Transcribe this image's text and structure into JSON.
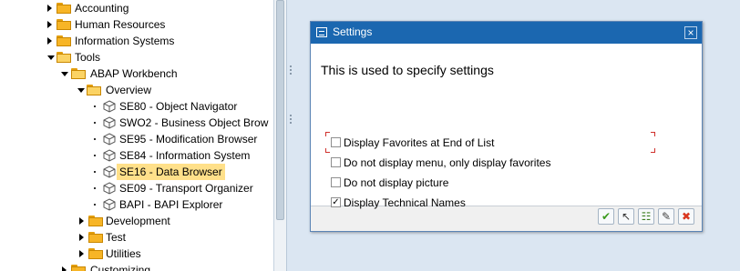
{
  "tree": {
    "items": [
      {
        "label": "Accounting"
      },
      {
        "label": "Human Resources"
      },
      {
        "label": "Information Systems"
      },
      {
        "label": "Tools"
      },
      {
        "label": "ABAP Workbench"
      },
      {
        "label": "Overview"
      },
      {
        "label": "SE80 - Object Navigator"
      },
      {
        "label": "SWO2 - Business Object Brow"
      },
      {
        "label": "SE95 - Modification Browser"
      },
      {
        "label": "SE84 - Information System"
      },
      {
        "label": "SE16 - Data Browser"
      },
      {
        "label": "SE09 - Transport Organizer"
      },
      {
        "label": "BAPI - BAPI Explorer"
      },
      {
        "label": "Development"
      },
      {
        "label": "Test"
      },
      {
        "label": "Utilities"
      },
      {
        "label": "Customizing"
      }
    ]
  },
  "dialog": {
    "title": "Settings",
    "close_glyph": "×",
    "heading": "This is used to specify settings",
    "options": [
      {
        "label": "Display Favorites at End of List",
        "checked": false,
        "mark": ""
      },
      {
        "label": "Do not display menu, only display favorites",
        "checked": false,
        "mark": ""
      },
      {
        "label": "Do not display picture",
        "checked": false,
        "mark": ""
      },
      {
        "label": "Display Technical Names",
        "checked": true,
        "mark": "✓"
      }
    ],
    "buttons": [
      {
        "name": "continue-button",
        "icon": "checkmark-icon",
        "glyph": "✔",
        "color": "#3a9a1e"
      },
      {
        "name": "fetch-button",
        "icon": "cursor-icon",
        "glyph": "↖",
        "color": "#333333"
      },
      {
        "name": "select-button",
        "icon": "list-edit-icon",
        "glyph": "☷",
        "color": "#3a7d1e"
      },
      {
        "name": "edit-button",
        "icon": "page-edit-icon",
        "glyph": "✎",
        "color": "#444444"
      },
      {
        "name": "cancel-button",
        "icon": "cancel-icon",
        "glyph": "✖",
        "color": "#d9361e"
      }
    ]
  },
  "colors": {
    "titlebar": "#1b67b0",
    "selection": "#ffe08a",
    "folder": "#f7b526",
    "background": "#dbe6f2"
  }
}
